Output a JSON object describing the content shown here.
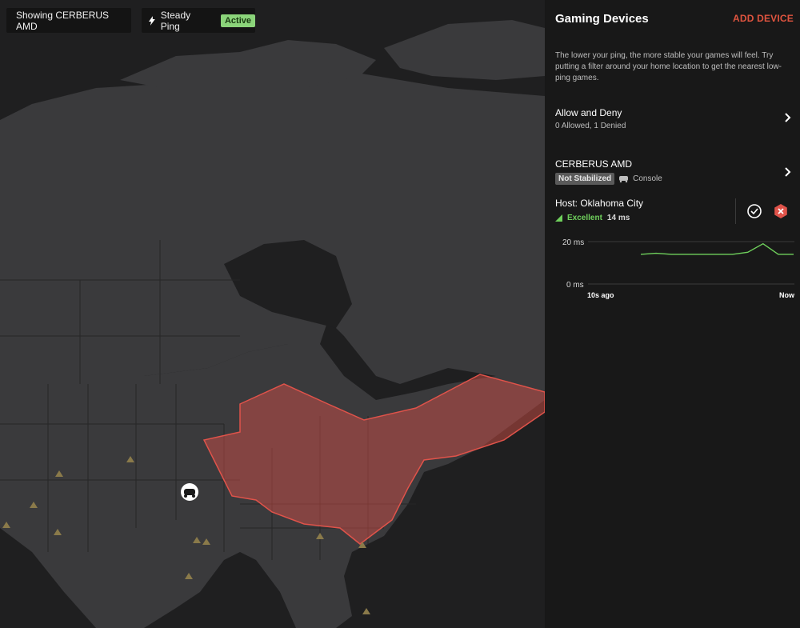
{
  "map_overlay": {
    "device_pill": {
      "label": "Showing CERBERUS AMD",
      "icon": "chevron-icon"
    },
    "ping_pill": {
      "label": "Steady Ping",
      "status": "Active",
      "icon": "bolt-icon"
    },
    "marker_icon": "gamepad-icon",
    "region_color": "#e0534a",
    "server_marker_color": "#8a7a4a"
  },
  "panel": {
    "title": "Gaming Devices",
    "add_device_label": "ADD DEVICE",
    "description": "The lower your ping, the more stable your games will feel. Try putting a filter around your home location to get the nearest low-ping games.",
    "allow_deny": {
      "title": "Allow and Deny",
      "subtitle": "0 Allowed, 1 Denied"
    },
    "device": {
      "name": "CERBERUS AMD",
      "status": "Not Stabilized",
      "type": "Console"
    },
    "host": {
      "title": "Host: Oklahoma City",
      "quality": "Excellent",
      "ping": "14 ms"
    }
  },
  "chart_data": {
    "type": "line",
    "x": [
      "10s ago",
      "",
      "",
      "",
      "",
      "",
      "",
      "",
      "",
      "",
      "Now"
    ],
    "series": [
      {
        "values": [
          14,
          14.5,
          14,
          14,
          14,
          14,
          14,
          15,
          19,
          14,
          14
        ]
      }
    ],
    "ylim": [
      0,
      20
    ],
    "ytick_labels": [
      "20 ms",
      "0 ms"
    ],
    "xtick_labels": [
      "10s ago",
      "Now"
    ],
    "color": "#6fd05c"
  }
}
